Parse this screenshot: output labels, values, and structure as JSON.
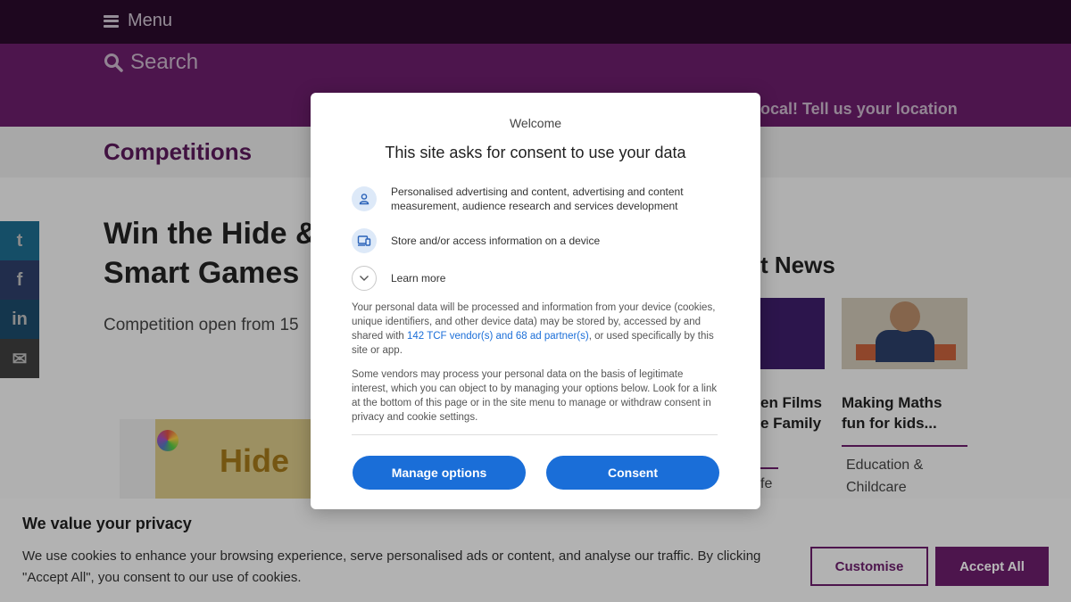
{
  "header": {
    "menu_label": "Menu",
    "search_label": "Search",
    "location_text": "ocal! Tell us your location"
  },
  "section": {
    "title": "Competitions"
  },
  "social": {
    "twitter": "t",
    "facebook": "f",
    "linkedin": "in",
    "email": "✉"
  },
  "article": {
    "title_line1": "Win the Hide &",
    "title_line2": "Smart Games",
    "competition_open": "Competition open from 15",
    "product_logo_text": "Hide"
  },
  "news": {
    "heading": "t News",
    "items": [
      {
        "caption_line1": "en Films",
        "caption_line2": "e Family",
        "category": "fe"
      },
      {
        "caption_line1": "Making Maths",
        "caption_line2": "fun for kids...",
        "category": "Education & Childcare"
      }
    ]
  },
  "consent_dialog": {
    "welcome": "Welcome",
    "heading": "This site asks for consent to use your data",
    "purposes": [
      {
        "icon": "person-icon",
        "text": "Personalised advertising and content, advertising and content measurement, audience research and services development"
      },
      {
        "icon": "device-icon",
        "text": "Store and/or access information on a device"
      }
    ],
    "learn_more": "Learn more",
    "paragraph1_before": "Your personal data will be processed and information from your device (cookies, unique identifiers, and other device data) may be stored by, accessed by and shared with ",
    "paragraph1_link": "142 TCF vendor(s) and 68 ad partner(s)",
    "paragraph1_after": ", or used specifically by this site or app.",
    "paragraph2": "Some vendors may process your personal data on the basis of legitimate interest, which you can object to by managing your options below. Look for a link at the bottom of this page or in the site menu to manage or withdraw consent in privacy and cookie settings.",
    "manage_label": "Manage options",
    "consent_label": "Consent",
    "colors": {
      "button": "#1a6ed8",
      "icon_bg": "#dde9f8"
    }
  },
  "privacy_banner": {
    "title": "We value your privacy",
    "text": "We use cookies to enhance your browsing experience, serve personalised ads or content, and analyse our traffic. By clicking \"Accept All\", you consent to our use of cookies.",
    "customise_label": "Customise",
    "accept_label": "Accept All",
    "colors": {
      "brand": "#6b1e6b"
    }
  }
}
